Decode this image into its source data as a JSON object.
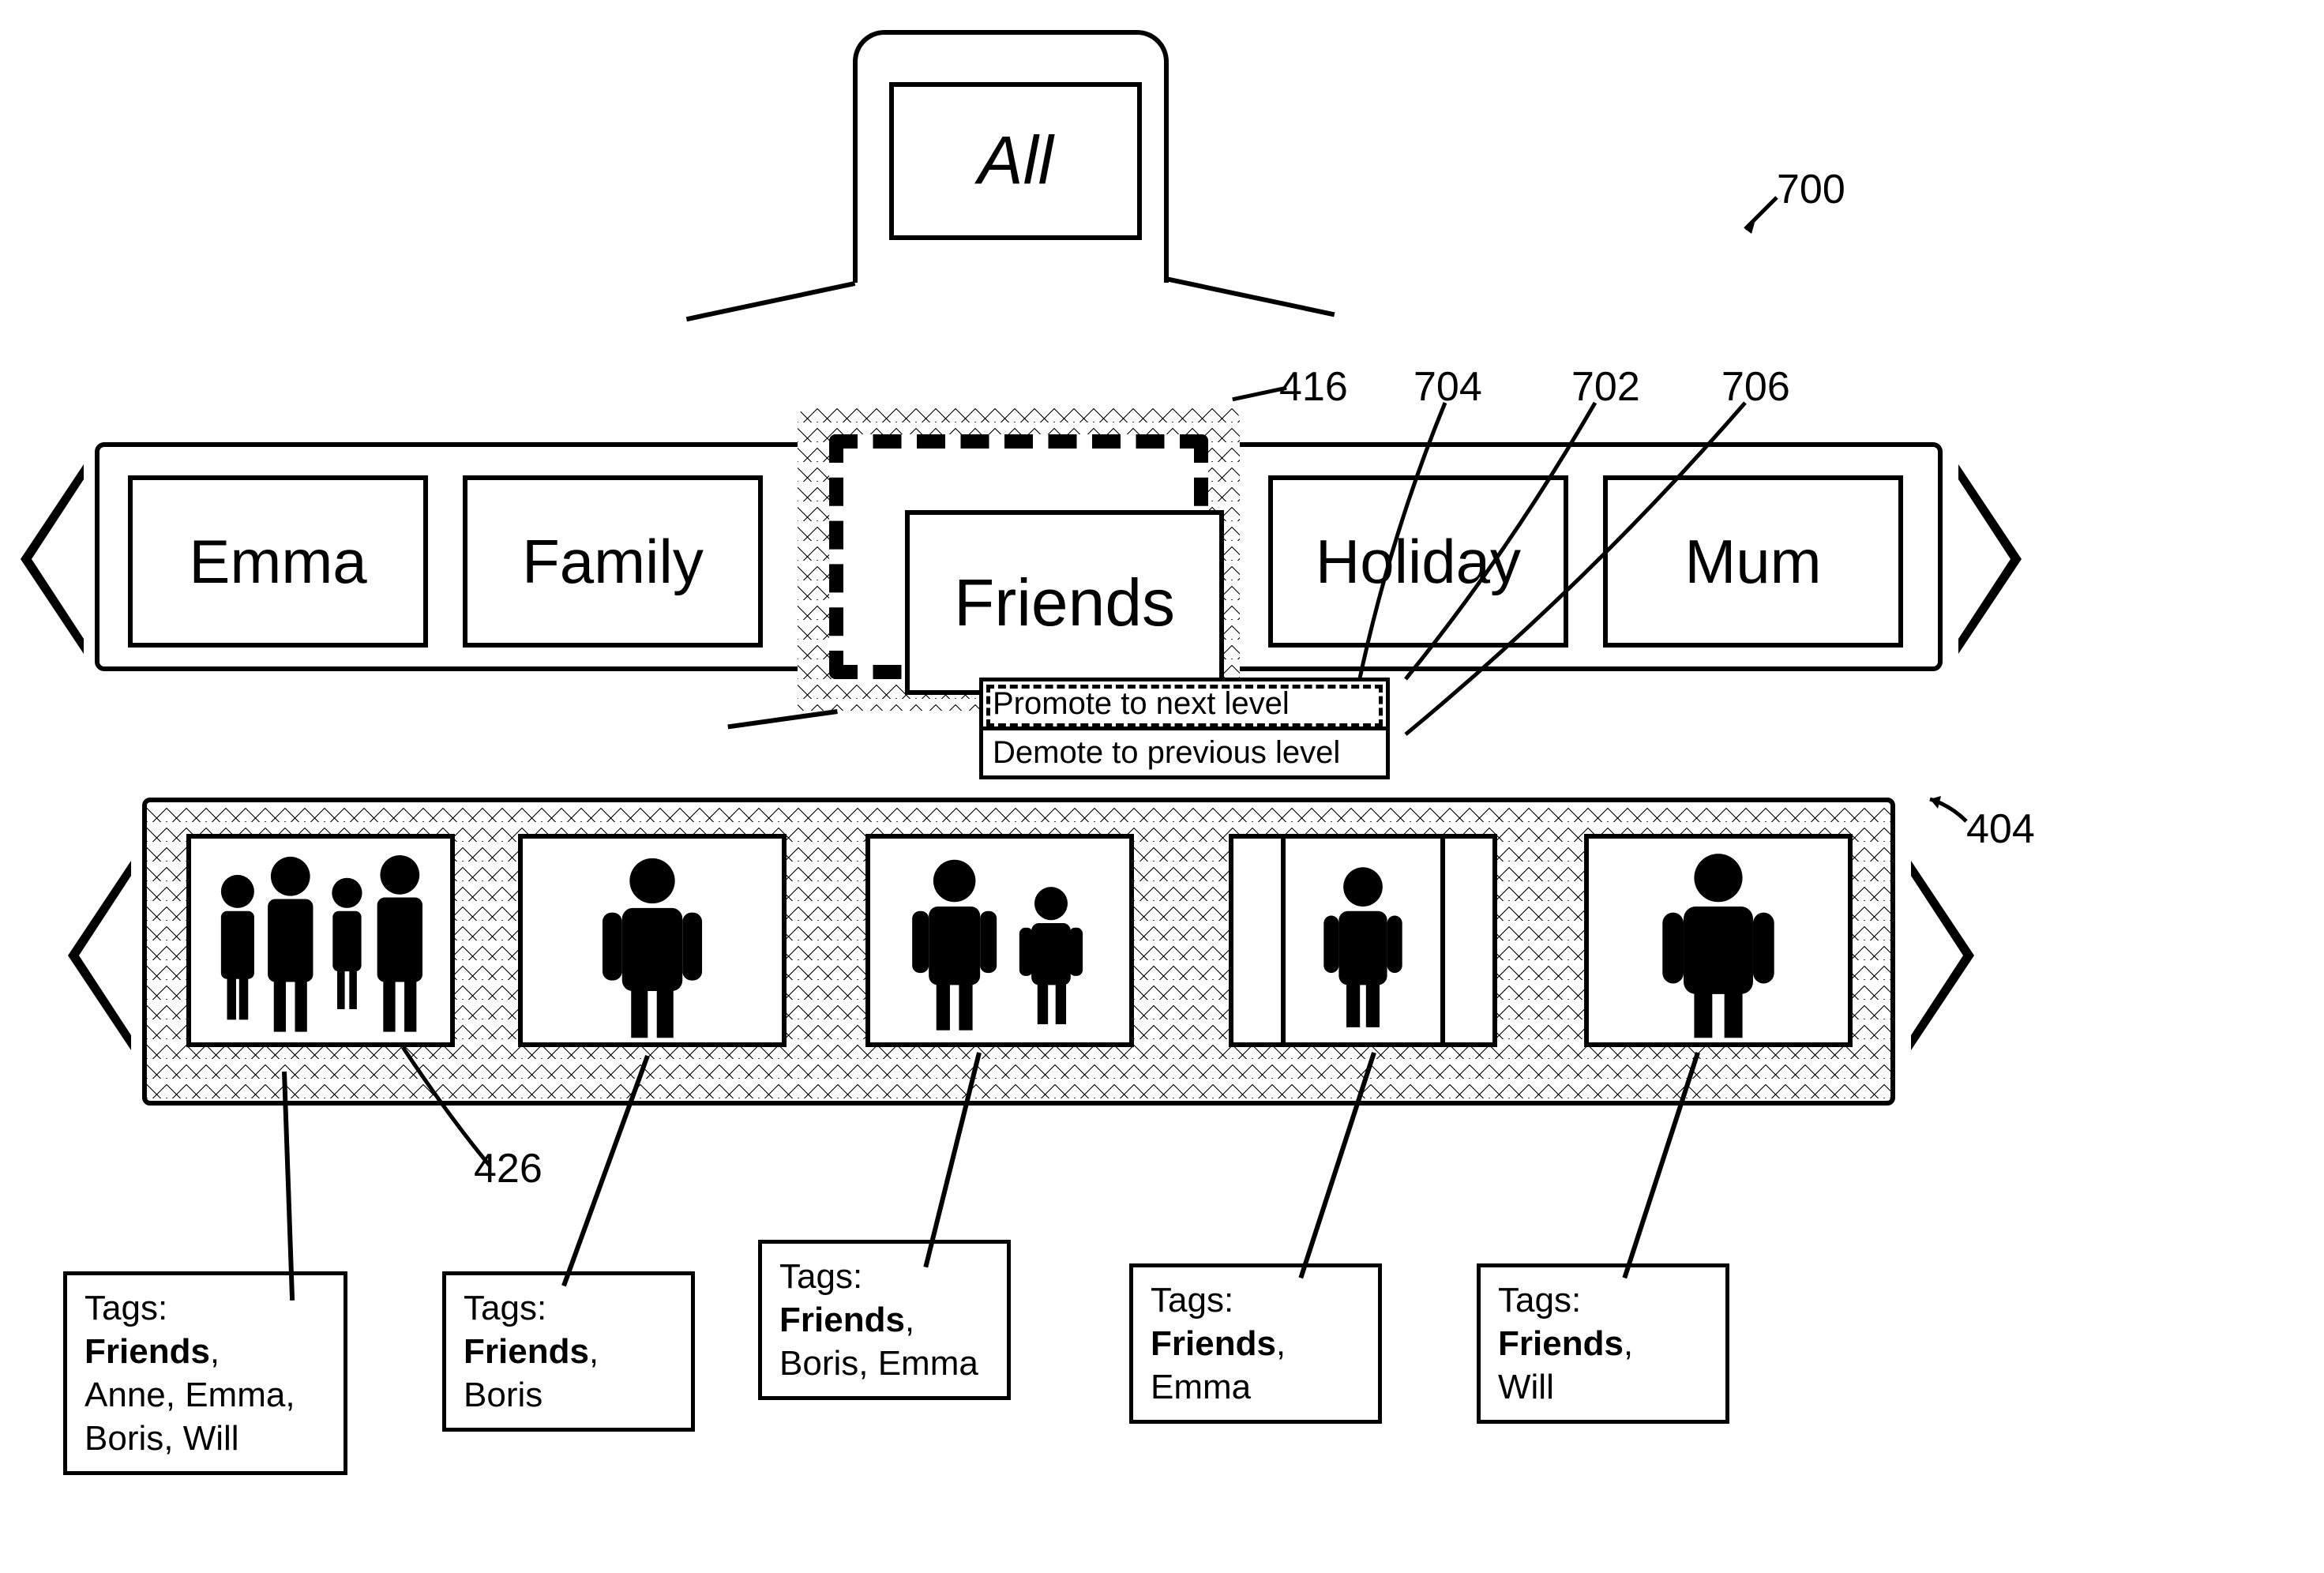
{
  "top": {
    "label": "All"
  },
  "categories": {
    "left": [
      {
        "label": "Emma"
      },
      {
        "label": "Family"
      }
    ],
    "center": {
      "label": "Friends"
    },
    "right": [
      {
        "label": "Holiday"
      },
      {
        "label": "Mum"
      }
    ]
  },
  "context_menu": {
    "promote": "Promote to next level",
    "demote": "Demote to previous level"
  },
  "thumbnails": {
    "tags_label": "Tags:",
    "items": [
      {
        "bold_tag": "Friends",
        "other_tags": "Anne, Emma, Boris, Will"
      },
      {
        "bold_tag": "Friends",
        "other_tags": "Boris"
      },
      {
        "bold_tag": "Friends",
        "other_tags": "Boris, Emma"
      },
      {
        "bold_tag": "Friends",
        "other_tags": "Emma"
      },
      {
        "bold_tag": "Friends",
        "other_tags": "Will"
      }
    ]
  },
  "refs": {
    "r700": "700",
    "r416": "416",
    "r704": "704",
    "r702": "702",
    "r706": "706",
    "r404": "404",
    "r426": "426"
  }
}
